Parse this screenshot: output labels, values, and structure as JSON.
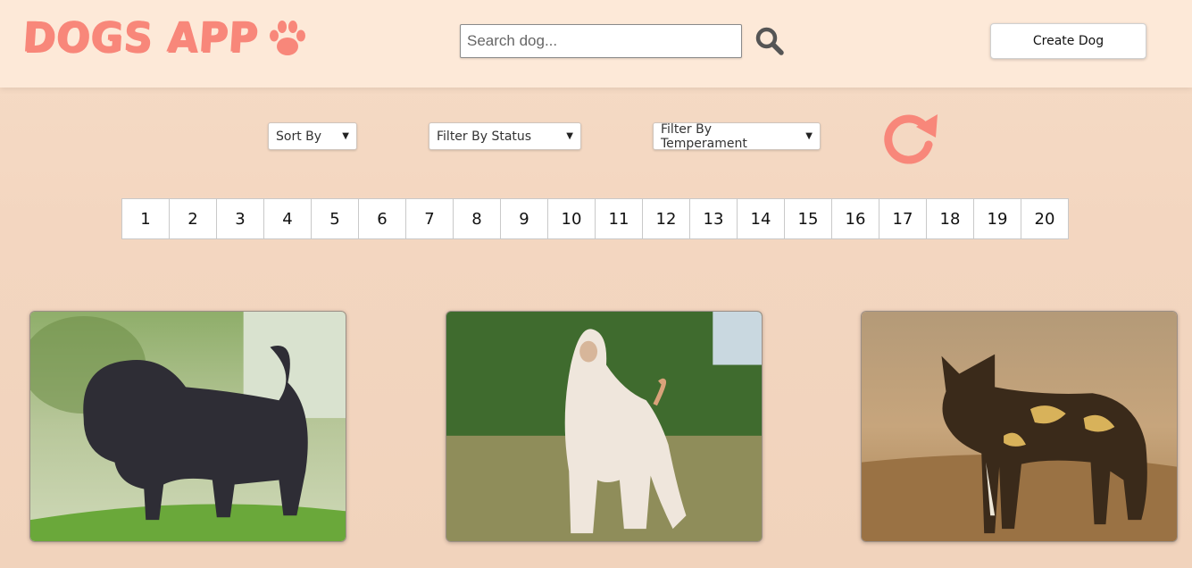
{
  "app": {
    "title": "DOGS APP",
    "logo_icon": "paw-icon",
    "accent_color": "#f8877a"
  },
  "header": {
    "search": {
      "placeholder": "Search dog...",
      "value": "",
      "icon": "search-icon"
    },
    "create_button_label": "Create Dog"
  },
  "filters": {
    "sort": {
      "selected": "Sort By"
    },
    "status": {
      "selected": "Filter By Status"
    },
    "temperament": {
      "selected": "Filter By Temperament"
    },
    "reset_icon": "refresh-icon"
  },
  "pagination": {
    "pages": [
      "1",
      "2",
      "3",
      "4",
      "5",
      "6",
      "7",
      "8",
      "9",
      "10",
      "11",
      "12",
      "13",
      "14",
      "15",
      "16",
      "17",
      "18",
      "19",
      "20"
    ]
  },
  "cards": [
    {
      "image": "black-shaggy-dog-photo"
    },
    {
      "image": "afghan-hound-photo"
    },
    {
      "image": "african-wild-dog-photo"
    }
  ]
}
